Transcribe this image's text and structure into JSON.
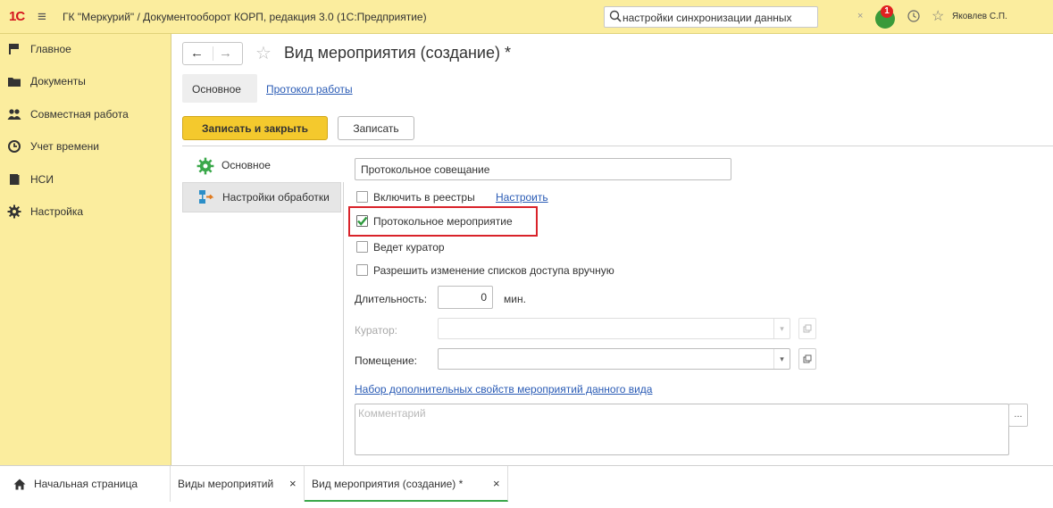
{
  "topbar": {
    "logo": "1С",
    "app_title": "ГК \"Меркурий\" / Документооборот КОРП, редакция 3.0  (1С:Предприятие)",
    "search_value": "настройки синхронизации данных",
    "search_clear": "×",
    "notification_count": "1",
    "user_name": "Яковлев С.П."
  },
  "sidebar": {
    "items": [
      {
        "label": "Главное",
        "icon": "flag-icon"
      },
      {
        "label": "Документы",
        "icon": "folder-icon"
      },
      {
        "label": "Совместная работа",
        "icon": "people-icon"
      },
      {
        "label": "Учет времени",
        "icon": "clock-icon"
      },
      {
        "label": "НСИ",
        "icon": "book-icon"
      },
      {
        "label": "Настройка",
        "icon": "gear-icon"
      }
    ]
  },
  "form": {
    "title": "Вид мероприятия (создание) *",
    "tabs": {
      "main": "Основное",
      "log": "Протокол работы"
    },
    "buttons": {
      "save_close": "Записать и закрыть",
      "save": "Записать"
    },
    "side_tabs": {
      "main": "Основное",
      "processing": "Настройки обработки"
    },
    "name_value": "Протокольное совещание",
    "checkbox_registers": {
      "label": "Включить в реестры",
      "checked": false
    },
    "configure_link": "Настроить",
    "checkbox_protocol": {
      "label": "Протокольное мероприятие",
      "checked": true
    },
    "checkbox_curator": {
      "label": "Ведет куратор",
      "checked": false
    },
    "checkbox_access": {
      "label": "Разрешить изменение списков доступа вручную",
      "checked": false
    },
    "duration_label": "Длительность:",
    "duration_value": "0",
    "duration_unit": "мин.",
    "curator_label": "Куратор:",
    "room_label": "Помещение:",
    "properties_link": "Набор дополнительных свойств мероприятий данного вида",
    "comment_placeholder": "Комментарий",
    "ellipsis": "..."
  },
  "bottom_tabs": [
    {
      "label": "Начальная страница"
    },
    {
      "label": "Виды мероприятий",
      "close": "×"
    },
    {
      "label": "Вид мероприятия (создание) *",
      "close": "×"
    }
  ],
  "colors": {
    "panel_bg": "#fbed9e",
    "primary_button": "#f4c92d",
    "link": "#2a5bb5",
    "highlight": "#d9232a",
    "check": "#2e9a3e"
  }
}
